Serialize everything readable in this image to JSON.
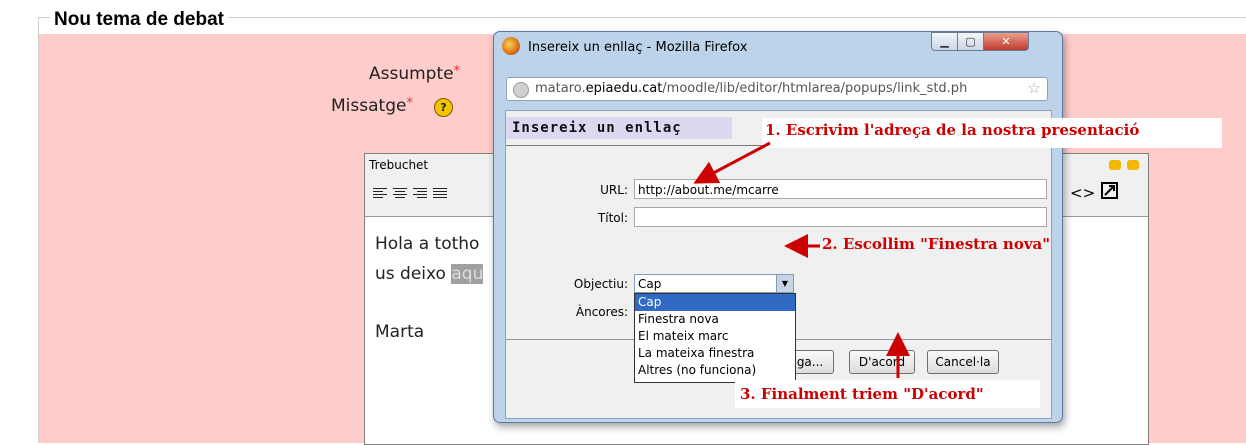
{
  "form": {
    "legend": "Nou tema de debat",
    "subject_label": "Assumpte",
    "message_label": "Missatge",
    "required_mark": "*",
    "help_symbol": "?"
  },
  "editor": {
    "font": "Trebuchet",
    "body_line1": "Hola a totho",
    "body_line2_prefix": "us deixo ",
    "body_line2_selected": "aqu",
    "signature": "Marta",
    "toolbar_code_icon": "<>",
    "toolbar_link_icon": "link-icon"
  },
  "dialog": {
    "window_title": "Insereix un enllaç - Mozilla Firefox",
    "url_host_prefix": "mataro.",
    "url_host_domain": "epiaedu.cat",
    "url_path": "/moodle/lib/editor/htmlarea/popups/link_std.ph",
    "heading": "Insereix un enllaç",
    "url_label": "URL:",
    "url_value": "http://about.me/mcarre",
    "title_label": "Títol:",
    "title_value": "",
    "target_label": "Objectiu:",
    "target_value": "Cap",
    "anchors_label": "Àncores:",
    "target_options": [
      "Cap",
      "Finestra nova",
      "El mateix marc",
      "La mateixa finestra",
      "Altres (no funciona)"
    ],
    "browse_button": "rega...",
    "ok_button": "D'acord",
    "cancel_button": "Cancel·la"
  },
  "annotations": {
    "step1": "1. Escrivim l'adreça de la nostra presentació",
    "step2": "2. Escollim \"Finestra nova\"",
    "step3": "3. Finalment triem \"D'acord\"",
    "color": "#cc0000"
  },
  "colors": {
    "form_background": "#ffcccc",
    "dialog_frame": "#bcd3ea",
    "selected_option": "#316ac5"
  }
}
